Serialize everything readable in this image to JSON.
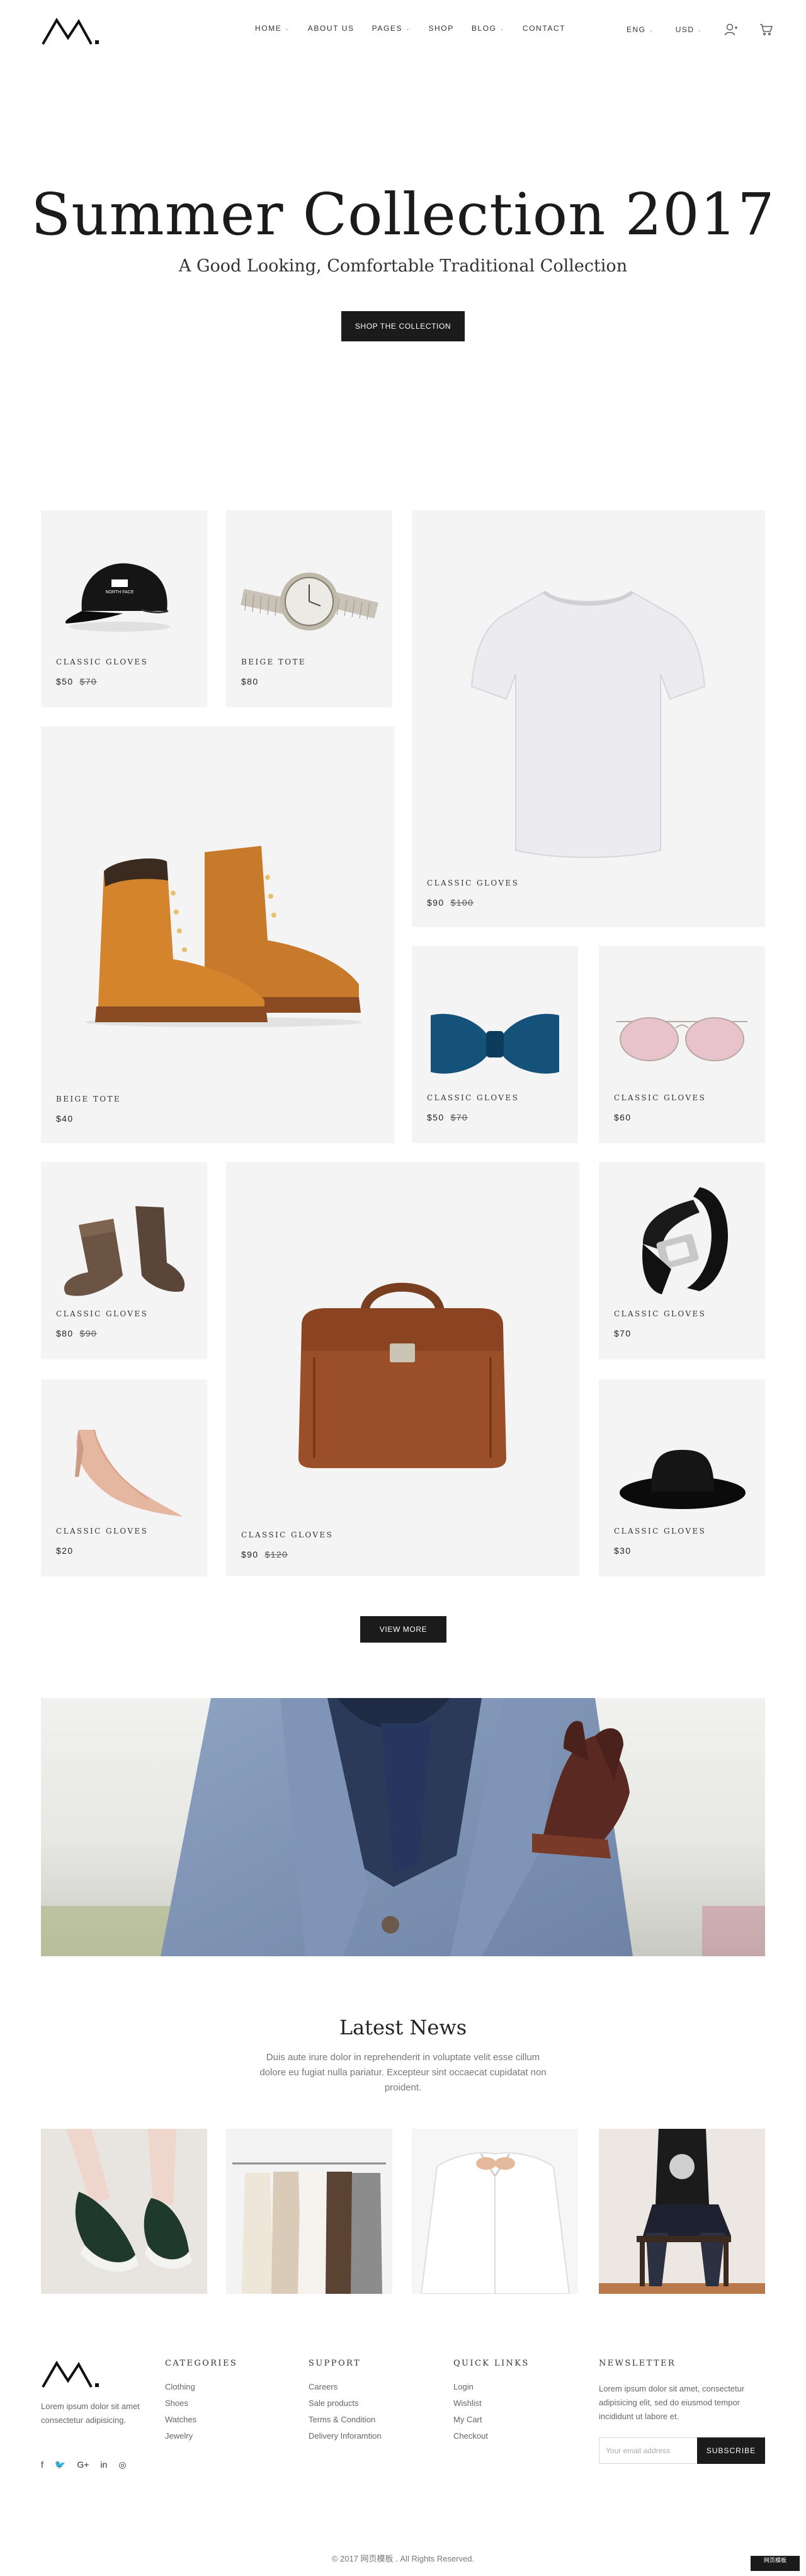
{
  "header": {
    "nav": [
      {
        "label": "HOME",
        "caret": "⌄"
      },
      {
        "label": "ABOUT US",
        "caret": ""
      },
      {
        "label": "PAGES",
        "caret": "⌄"
      },
      {
        "label": "SHOP",
        "caret": ""
      },
      {
        "label": "BLOG",
        "caret": "⌄"
      },
      {
        "label": "CONTACT",
        "caret": ""
      }
    ],
    "language": "ENG",
    "currency": "USD",
    "caret": "⌄",
    "icons": [
      "logo-mountain-icon",
      "user-add-icon",
      "cart-icon",
      "chevron-down-icon"
    ]
  },
  "hero": {
    "title": "Summer Collection 2017",
    "subtitle": "A Good Looking, Comfortable Traditional Collection",
    "button": "SHOP THE COLLECTION"
  },
  "products": [
    {
      "name": "CLASSIC GLOVES",
      "price": "$50",
      "old_price": "$70",
      "image": "cap"
    },
    {
      "name": "BEIGE TOTE",
      "price": "$80",
      "old_price": "",
      "image": "watch"
    },
    {
      "name": "CLASSIC GLOVES",
      "price": "$90",
      "old_price": "$100",
      "image": "tshirt"
    },
    {
      "name": "BEIGE TOTE",
      "price": "$40",
      "old_price": "",
      "image": "boots"
    },
    {
      "name": "CLASSIC GLOVES",
      "price": "$50",
      "old_price": "$70",
      "image": "bowtie"
    },
    {
      "name": "CLASSIC GLOVES",
      "price": "$60",
      "old_price": "",
      "image": "sunglasses"
    },
    {
      "name": "CLASSIC GLOVES",
      "price": "$80",
      "old_price": "$90",
      "image": "socks"
    },
    {
      "name": "CLASSIC GLOVES",
      "price": "$90",
      "old_price": "$120",
      "image": "briefcase"
    },
    {
      "name": "CLASSIC GLOVES",
      "price": "$70",
      "old_price": "",
      "image": "belt"
    },
    {
      "name": "CLASSIC GLOVES",
      "price": "$20",
      "old_price": "",
      "image": "heels"
    },
    {
      "name": "CLASSIC GLOVES",
      "price": "$30",
      "old_price": "",
      "image": "hat"
    }
  ],
  "view_more": "VIEW MORE",
  "news": {
    "title": "Latest News",
    "text": "Duis aute irure dolor in reprehenderit in voluptate velit esse cillum dolore eu fugiat nulla pariatur. Excepteur sint occaecat cupidatat non proident."
  },
  "footer": {
    "about": "Lorem ipsum dolor sit amet consectetur adipisicing.",
    "socials": [
      "f",
      "🐦",
      "G+",
      "in",
      "◎"
    ],
    "social_icons": [
      "facebook-icon",
      "twitter-icon",
      "google-plus-icon",
      "linkedin-icon",
      "instagram-icon"
    ],
    "categories": {
      "title": "CATEGORIES",
      "links": [
        "Clothing",
        "Shoes",
        "Watches",
        "Jewelry"
      ]
    },
    "support": {
      "title": "SUPPORT",
      "links": [
        "Careers",
        "Sale products",
        "Terms & Condition",
        "Delivery Inforamtion"
      ]
    },
    "quick_links": {
      "title": "QUICK LINKS",
      "links": [
        "Login",
        "Wishlist",
        "My Cart",
        "Checkout"
      ]
    },
    "newsletter": {
      "title": "NEWSLETTER",
      "text": "Lorem ipsum dolor sit amet, consectetur adipisicing elit, sed do eiusmod tempor incididunt ut labore et.",
      "placeholder": "Your email address",
      "button": "SUBSCRIBE"
    },
    "copyright": "© 2017 网页模板 . All Rights Reserved.",
    "watermark": "网页模板"
  },
  "colors": {
    "dark": "#1b1b1b",
    "card_bg": "#f4f4f4",
    "text_muted": "#777777"
  }
}
